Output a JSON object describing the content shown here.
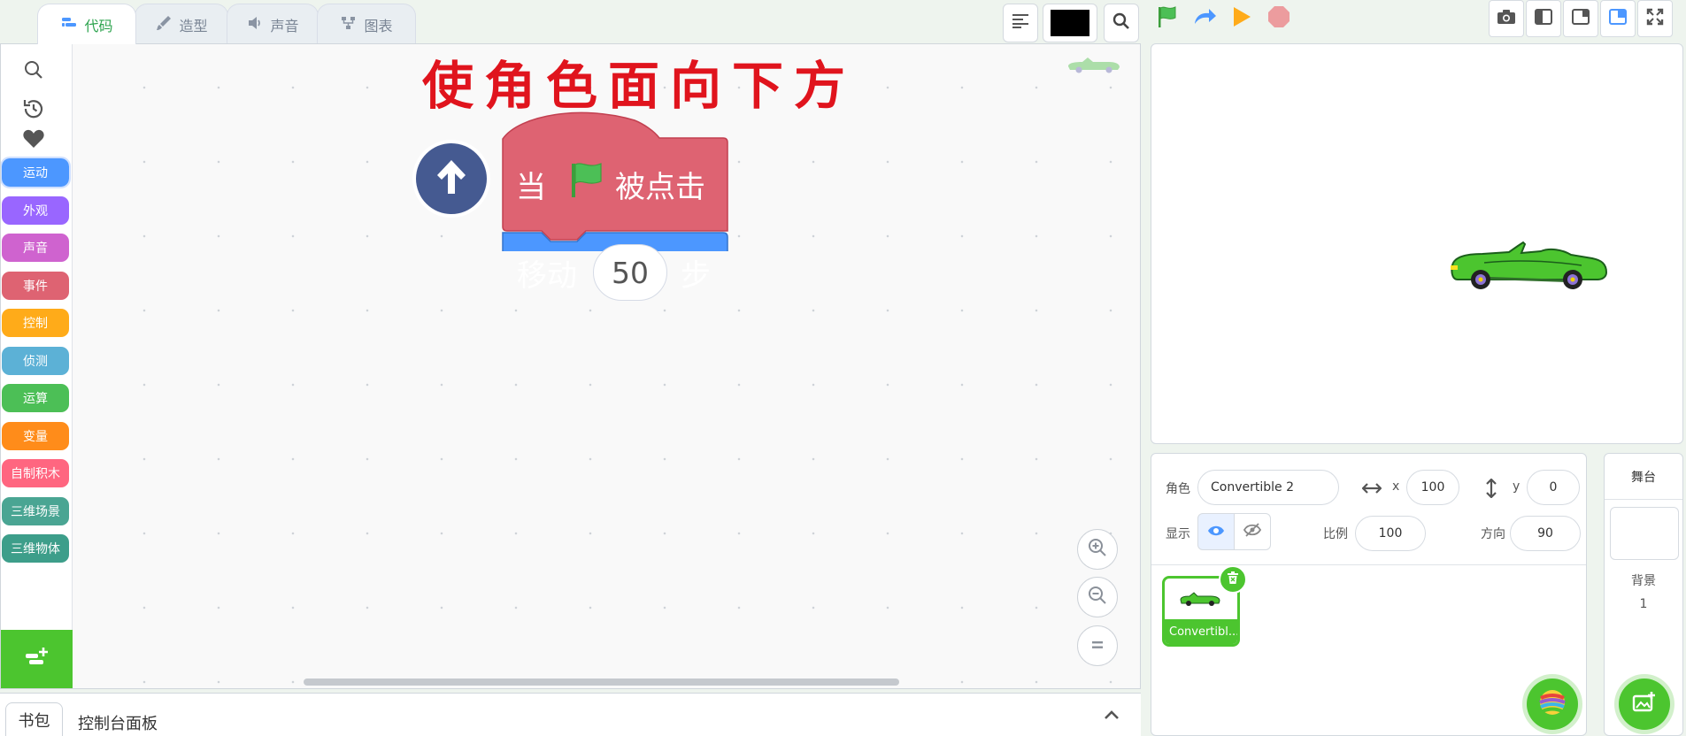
{
  "tabs": [
    {
      "label": "代码",
      "icon": "code-icon",
      "active": true
    },
    {
      "label": "造型",
      "icon": "brush-icon",
      "active": false
    },
    {
      "label": "声音",
      "icon": "speaker-icon",
      "active": false
    },
    {
      "label": "图表",
      "icon": "chart-icon",
      "active": false
    }
  ],
  "toolbar": {
    "align_icon": "align-left-icon",
    "color_swatch": "#000000",
    "search_icon": "search-icon"
  },
  "run_controls": {
    "green_flag": "green-flag-icon",
    "redo": "redo-icon",
    "play": "play-icon",
    "stop": "stop-icon"
  },
  "layout_buttons": [
    "camera-icon",
    "small-stage-icon",
    "right-panel-icon",
    "split-layout-icon",
    "fullscreen-icon"
  ],
  "categories": [
    {
      "label": "运动",
      "color": "#4c97ff",
      "active": true
    },
    {
      "label": "外观",
      "color": "#9966ff",
      "active": false
    },
    {
      "label": "声音",
      "color": "#cf63cf",
      "active": false
    },
    {
      "label": "事件",
      "color": "#de6372",
      "active": false
    },
    {
      "label": "控制",
      "color": "#ffab19",
      "active": false
    },
    {
      "label": "侦测",
      "color": "#5cb1d6",
      "active": false
    },
    {
      "label": "运算",
      "color": "#4cbf56",
      "active": false
    },
    {
      "label": "变量",
      "color": "#ff8c1a",
      "active": false
    },
    {
      "label": "自制积木",
      "color": "#ff6680",
      "active": false
    },
    {
      "label": "三维场景",
      "color": "#4aa593",
      "active": false
    },
    {
      "label": "三维物体",
      "color": "#3d9e8a",
      "active": false
    }
  ],
  "workspace": {
    "title": "使角色面向下方",
    "hat_block": {
      "pre": "当",
      "post": "被点击",
      "color": "#de6372"
    },
    "move_block": {
      "pre": "移动",
      "value": "50",
      "post": "步",
      "color": "#4c97ff"
    }
  },
  "bottom_panel": {
    "tab": "书包",
    "label": "控制台面板"
  },
  "sprite": {
    "sprite_label": "角色",
    "name": "Convertible 2",
    "x_label": "x",
    "x": "100",
    "y_label": "y",
    "y": "0",
    "show_label": "显示",
    "size_label": "比例",
    "size": "100",
    "direction_label": "方向",
    "direction": "90",
    "tile_name": "Convertibl..."
  },
  "stage_selector": {
    "title": "舞台",
    "backdrop_label": "背景",
    "backdrop_count": "1"
  },
  "accent": "#4cc52f"
}
